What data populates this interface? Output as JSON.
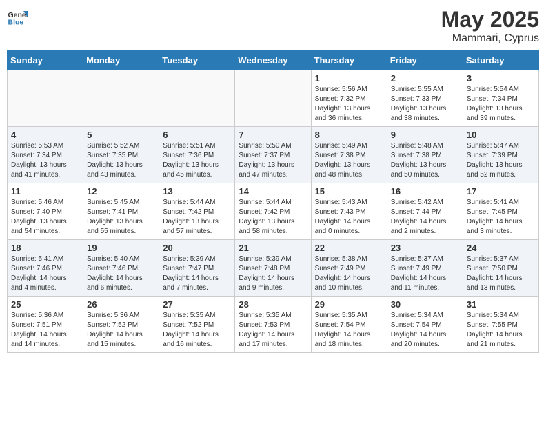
{
  "logo": {
    "general": "General",
    "blue": "Blue"
  },
  "title": "May 2025",
  "location": "Mammari, Cyprus",
  "days_of_week": [
    "Sunday",
    "Monday",
    "Tuesday",
    "Wednesday",
    "Thursday",
    "Friday",
    "Saturday"
  ],
  "weeks": [
    [
      {
        "day": "",
        "sunrise": "",
        "sunset": "",
        "daylight": ""
      },
      {
        "day": "",
        "sunrise": "",
        "sunset": "",
        "daylight": ""
      },
      {
        "day": "",
        "sunrise": "",
        "sunset": "",
        "daylight": ""
      },
      {
        "day": "",
        "sunrise": "",
        "sunset": "",
        "daylight": ""
      },
      {
        "day": "1",
        "sunrise": "Sunrise: 5:56 AM",
        "sunset": "Sunset: 7:32 PM",
        "daylight": "Daylight: 13 hours and 36 minutes."
      },
      {
        "day": "2",
        "sunrise": "Sunrise: 5:55 AM",
        "sunset": "Sunset: 7:33 PM",
        "daylight": "Daylight: 13 hours and 38 minutes."
      },
      {
        "day": "3",
        "sunrise": "Sunrise: 5:54 AM",
        "sunset": "Sunset: 7:34 PM",
        "daylight": "Daylight: 13 hours and 39 minutes."
      }
    ],
    [
      {
        "day": "4",
        "sunrise": "Sunrise: 5:53 AM",
        "sunset": "Sunset: 7:34 PM",
        "daylight": "Daylight: 13 hours and 41 minutes."
      },
      {
        "day": "5",
        "sunrise": "Sunrise: 5:52 AM",
        "sunset": "Sunset: 7:35 PM",
        "daylight": "Daylight: 13 hours and 43 minutes."
      },
      {
        "day": "6",
        "sunrise": "Sunrise: 5:51 AM",
        "sunset": "Sunset: 7:36 PM",
        "daylight": "Daylight: 13 hours and 45 minutes."
      },
      {
        "day": "7",
        "sunrise": "Sunrise: 5:50 AM",
        "sunset": "Sunset: 7:37 PM",
        "daylight": "Daylight: 13 hours and 47 minutes."
      },
      {
        "day": "8",
        "sunrise": "Sunrise: 5:49 AM",
        "sunset": "Sunset: 7:38 PM",
        "daylight": "Daylight: 13 hours and 48 minutes."
      },
      {
        "day": "9",
        "sunrise": "Sunrise: 5:48 AM",
        "sunset": "Sunset: 7:38 PM",
        "daylight": "Daylight: 13 hours and 50 minutes."
      },
      {
        "day": "10",
        "sunrise": "Sunrise: 5:47 AM",
        "sunset": "Sunset: 7:39 PM",
        "daylight": "Daylight: 13 hours and 52 minutes."
      }
    ],
    [
      {
        "day": "11",
        "sunrise": "Sunrise: 5:46 AM",
        "sunset": "Sunset: 7:40 PM",
        "daylight": "Daylight: 13 hours and 54 minutes."
      },
      {
        "day": "12",
        "sunrise": "Sunrise: 5:45 AM",
        "sunset": "Sunset: 7:41 PM",
        "daylight": "Daylight: 13 hours and 55 minutes."
      },
      {
        "day": "13",
        "sunrise": "Sunrise: 5:44 AM",
        "sunset": "Sunset: 7:42 PM",
        "daylight": "Daylight: 13 hours and 57 minutes."
      },
      {
        "day": "14",
        "sunrise": "Sunrise: 5:44 AM",
        "sunset": "Sunset: 7:42 PM",
        "daylight": "Daylight: 13 hours and 58 minutes."
      },
      {
        "day": "15",
        "sunrise": "Sunrise: 5:43 AM",
        "sunset": "Sunset: 7:43 PM",
        "daylight": "Daylight: 14 hours and 0 minutes."
      },
      {
        "day": "16",
        "sunrise": "Sunrise: 5:42 AM",
        "sunset": "Sunset: 7:44 PM",
        "daylight": "Daylight: 14 hours and 2 minutes."
      },
      {
        "day": "17",
        "sunrise": "Sunrise: 5:41 AM",
        "sunset": "Sunset: 7:45 PM",
        "daylight": "Daylight: 14 hours and 3 minutes."
      }
    ],
    [
      {
        "day": "18",
        "sunrise": "Sunrise: 5:41 AM",
        "sunset": "Sunset: 7:46 PM",
        "daylight": "Daylight: 14 hours and 4 minutes."
      },
      {
        "day": "19",
        "sunrise": "Sunrise: 5:40 AM",
        "sunset": "Sunset: 7:46 PM",
        "daylight": "Daylight: 14 hours and 6 minutes."
      },
      {
        "day": "20",
        "sunrise": "Sunrise: 5:39 AM",
        "sunset": "Sunset: 7:47 PM",
        "daylight": "Daylight: 14 hours and 7 minutes."
      },
      {
        "day": "21",
        "sunrise": "Sunrise: 5:39 AM",
        "sunset": "Sunset: 7:48 PM",
        "daylight": "Daylight: 14 hours and 9 minutes."
      },
      {
        "day": "22",
        "sunrise": "Sunrise: 5:38 AM",
        "sunset": "Sunset: 7:49 PM",
        "daylight": "Daylight: 14 hours and 10 minutes."
      },
      {
        "day": "23",
        "sunrise": "Sunrise: 5:37 AM",
        "sunset": "Sunset: 7:49 PM",
        "daylight": "Daylight: 14 hours and 11 minutes."
      },
      {
        "day": "24",
        "sunrise": "Sunrise: 5:37 AM",
        "sunset": "Sunset: 7:50 PM",
        "daylight": "Daylight: 14 hours and 13 minutes."
      }
    ],
    [
      {
        "day": "25",
        "sunrise": "Sunrise: 5:36 AM",
        "sunset": "Sunset: 7:51 PM",
        "daylight": "Daylight: 14 hours and 14 minutes."
      },
      {
        "day": "26",
        "sunrise": "Sunrise: 5:36 AM",
        "sunset": "Sunset: 7:52 PM",
        "daylight": "Daylight: 14 hours and 15 minutes."
      },
      {
        "day": "27",
        "sunrise": "Sunrise: 5:35 AM",
        "sunset": "Sunset: 7:52 PM",
        "daylight": "Daylight: 14 hours and 16 minutes."
      },
      {
        "day": "28",
        "sunrise": "Sunrise: 5:35 AM",
        "sunset": "Sunset: 7:53 PM",
        "daylight": "Daylight: 14 hours and 17 minutes."
      },
      {
        "day": "29",
        "sunrise": "Sunrise: 5:35 AM",
        "sunset": "Sunset: 7:54 PM",
        "daylight": "Daylight: 14 hours and 18 minutes."
      },
      {
        "day": "30",
        "sunrise": "Sunrise: 5:34 AM",
        "sunset": "Sunset: 7:54 PM",
        "daylight": "Daylight: 14 hours and 20 minutes."
      },
      {
        "day": "31",
        "sunrise": "Sunrise: 5:34 AM",
        "sunset": "Sunset: 7:55 PM",
        "daylight": "Daylight: 14 hours and 21 minutes."
      }
    ]
  ]
}
